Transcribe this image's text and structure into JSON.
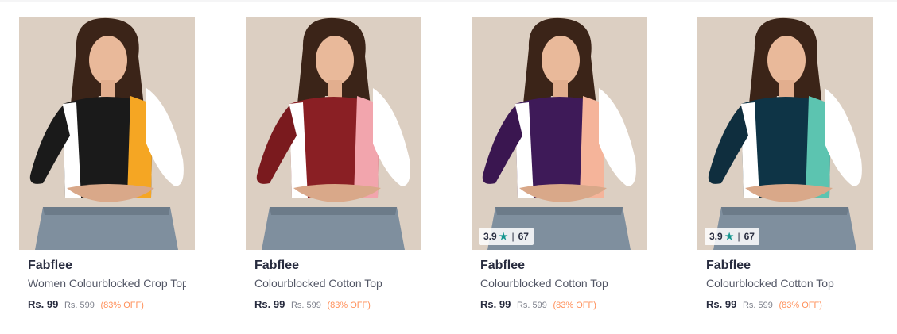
{
  "products": [
    {
      "brand": "Fabflee",
      "title": "Women Colourblocked Crop Top",
      "price": "Rs. 99",
      "mrp": "Rs. 599",
      "discount": "(83% OFF)",
      "rating": null,
      "image_alt": "Woman wearing black, white and yellow colourblocked crop top",
      "colors": {
        "left": "#1a1a1a",
        "center": "#1a1a1a",
        "right": "#f5a623"
      }
    },
    {
      "brand": "Fabflee",
      "title": "Colourblocked Cotton Top",
      "price": "Rs. 99",
      "mrp": "Rs. 599",
      "discount": "(83% OFF)",
      "rating": null,
      "image_alt": "Woman wearing maroon, white and pink colourblocked top",
      "colors": {
        "left": "#7a1a1e",
        "center": "#8a1f24",
        "right": "#f2a5ad"
      }
    },
    {
      "brand": "Fabflee",
      "title": "Colourblocked Cotton Top",
      "price": "Rs. 99",
      "mrp": "Rs. 599",
      "discount": "(83% OFF)",
      "rating": {
        "value": "3.9",
        "count": "67"
      },
      "image_alt": "Woman wearing purple, white and peach colourblocked top",
      "colors": {
        "left": "#3a1650",
        "center": "#3e1a58",
        "right": "#f5b49a"
      }
    },
    {
      "brand": "Fabflee",
      "title": "Colourblocked Cotton Top",
      "price": "Rs. 99",
      "mrp": "Rs. 599",
      "discount": "(83% OFF)",
      "rating": {
        "value": "3.9",
        "count": "67"
      },
      "image_alt": "Woman wearing navy, white and mint colourblocked top",
      "colors": {
        "left": "#0f2e3e",
        "center": "#0e3446",
        "right": "#5cc4b0"
      }
    }
  ],
  "ui": {
    "star_icon": "star-icon"
  }
}
